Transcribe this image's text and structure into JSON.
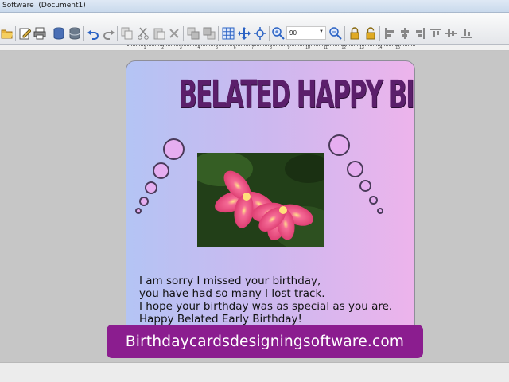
{
  "window": {
    "title": "Software  (Document1)"
  },
  "toolbar": {
    "zoom_value": "90",
    "buttons": [
      {
        "name": "open-icon",
        "color": "#e3a51f"
      },
      {
        "name": "edit-icon",
        "color": "#4a6fb5"
      },
      {
        "name": "print-icon",
        "color": "#666666"
      },
      {
        "name": "database-icon",
        "color": "#4a6fb5"
      },
      {
        "name": "database-stack-icon",
        "color": "#6b7a8c"
      },
      {
        "name": "undo-icon",
        "color": "#2a62c4"
      },
      {
        "name": "redo-icon",
        "color": "#8a8a8a"
      },
      {
        "name": "copy-icon",
        "color": "#9a9a9a"
      },
      {
        "name": "cut-icon",
        "color": "#9a9a9a"
      },
      {
        "name": "paste-icon",
        "color": "#9a9a9a"
      },
      {
        "name": "delete-icon",
        "color": "#9a9a9a"
      },
      {
        "name": "bring-front-icon",
        "color": "#9a9a9a"
      },
      {
        "name": "send-back-icon",
        "color": "#9a9a9a"
      },
      {
        "name": "grid-icon",
        "color": "#2a62c4"
      },
      {
        "name": "move-icon",
        "color": "#2a62c4"
      },
      {
        "name": "fit-icon",
        "color": "#2a62c4"
      },
      {
        "name": "zoom-in-icon",
        "color": "#2a62c4"
      },
      {
        "name": "zoom-out-icon",
        "color": "#2a62c4"
      },
      {
        "name": "lock-icon",
        "color": "#d9a21a"
      },
      {
        "name": "unlock-icon",
        "color": "#d9a21a"
      },
      {
        "name": "align-left-icon",
        "color": "#777777"
      },
      {
        "name": "align-center-icon",
        "color": "#777777"
      },
      {
        "name": "align-right-icon",
        "color": "#777777"
      },
      {
        "name": "align-top-icon",
        "color": "#777777"
      },
      {
        "name": "align-middle-icon",
        "color": "#777777"
      },
      {
        "name": "align-bottom-icon",
        "color": "#777777"
      }
    ]
  },
  "ruler": {
    "numbers": [
      "1",
      "2",
      "3",
      "4",
      "5",
      "6",
      "7",
      "8",
      "9",
      "10",
      "11",
      "12",
      "13",
      "14",
      "15"
    ]
  },
  "card": {
    "headline": "BELATED HAPPY BIRTHDAY",
    "photo_caption": "",
    "message_lines": [
      "I am sorry I missed your birthday,",
      "you have had so many I lost track.",
      "I hope your birthday was as special as you are.",
      "Happy Belated Early Birthday!"
    ],
    "colors": {
      "headline": "#5b1f6b",
      "bubble": "#e6aef0",
      "flower": "#e8457a"
    }
  },
  "banner": {
    "text": "Birthdaycardsdesigningsoftware.com",
    "color": "#8b1d8f"
  }
}
